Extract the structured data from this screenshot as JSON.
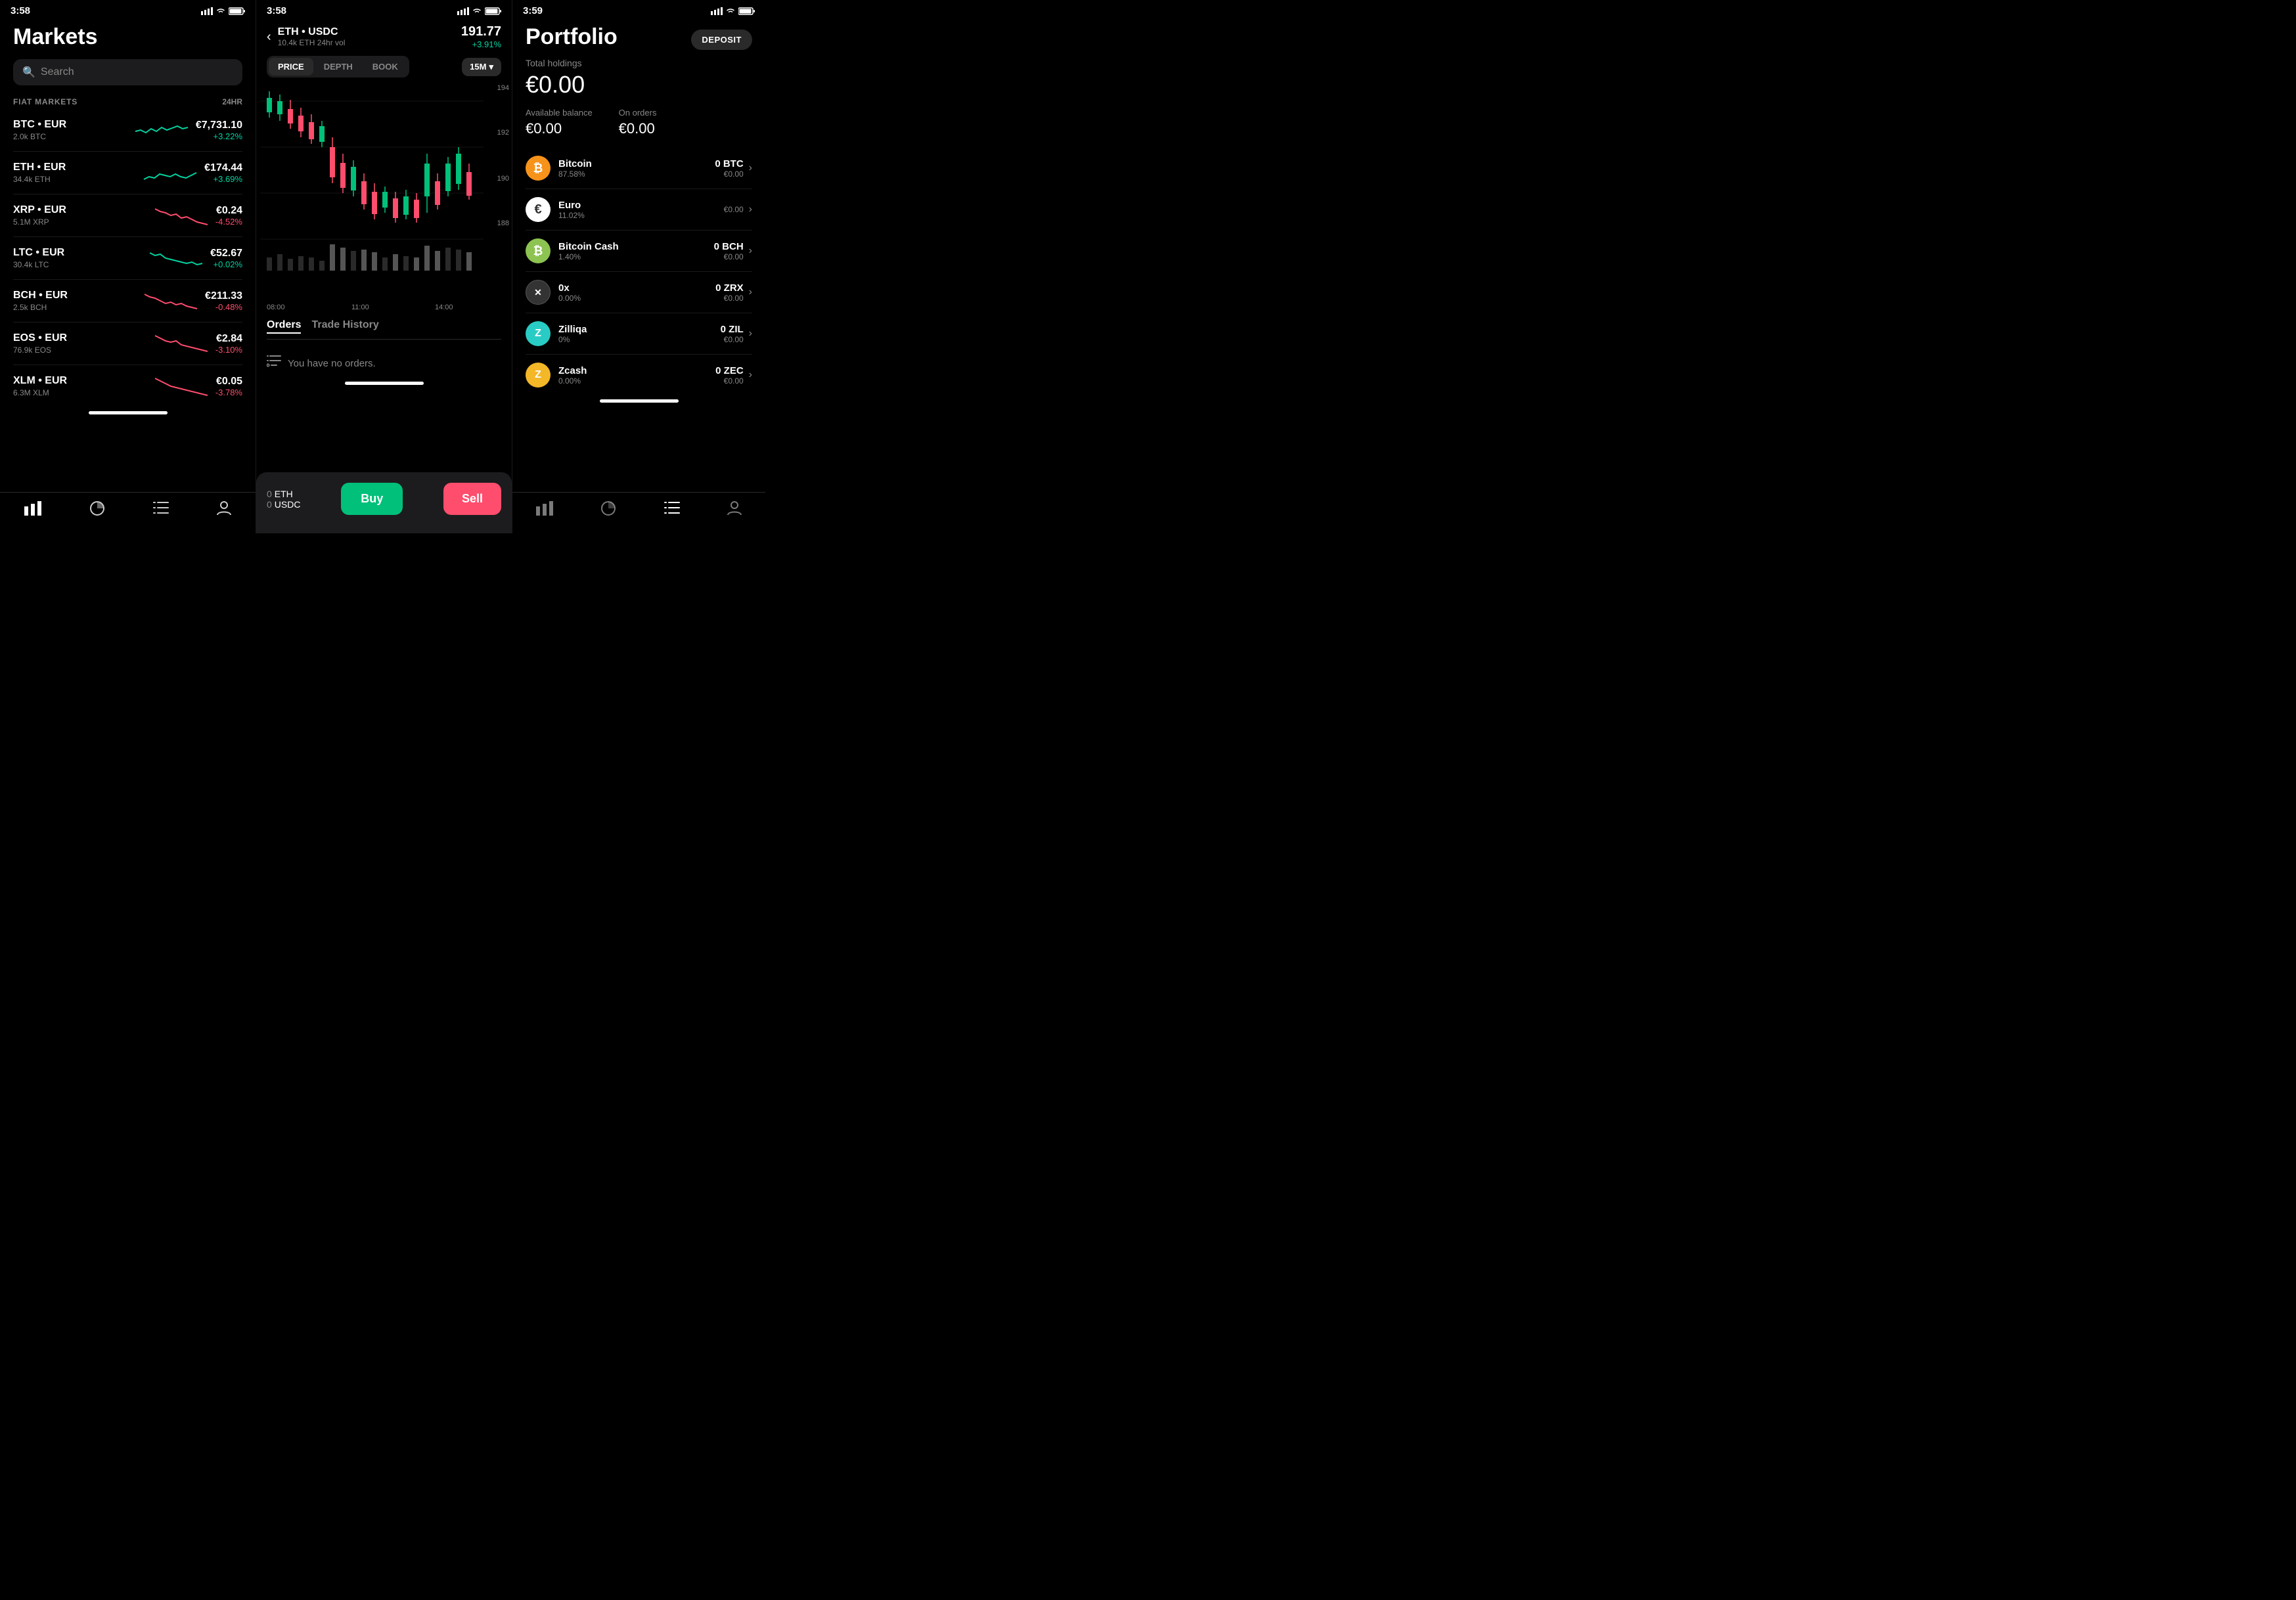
{
  "screens": {
    "left": {
      "status": {
        "time": "3:58",
        "icon": "location"
      },
      "title": "Markets",
      "search": {
        "placeholder": "Search"
      },
      "section": {
        "label": "FIAT MARKETS",
        "header24": "24HR"
      },
      "markets": [
        {
          "pair": "BTC • EUR",
          "vol": "2.0k BTC",
          "price": "€7,731.10",
          "change": "+3.22%",
          "positive": true
        },
        {
          "pair": "ETH • EUR",
          "vol": "34.4k ETH",
          "price": "€174.44",
          "change": "+3.69%",
          "positive": true
        },
        {
          "pair": "XRP • EUR",
          "vol": "5.1M XRP",
          "price": "€0.24",
          "change": "-4.52%",
          "positive": false
        },
        {
          "pair": "LTC • EUR",
          "vol": "30.4k LTC",
          "price": "€52.67",
          "change": "+0.02%",
          "positive": true
        },
        {
          "pair": "BCH • EUR",
          "vol": "2.5k BCH",
          "price": "€211.33",
          "change": "-0.48%",
          "positive": false
        },
        {
          "pair": "EOS • EUR",
          "vol": "76.9k EOS",
          "price": "€2.84",
          "change": "-3.10%",
          "positive": false
        },
        {
          "pair": "XLM • EUR",
          "vol": "6.3M XLM",
          "price": "€0.05",
          "change": "-3.78%",
          "positive": false
        }
      ],
      "nav": [
        "chart-bar",
        "pie-chart",
        "list",
        "person"
      ]
    },
    "middle": {
      "status": {
        "time": "3:58"
      },
      "pair": "ETH • USDC",
      "vol": "10.4k ETH 24hr vol",
      "price": "191.77",
      "change": "+3.91%",
      "tabs": [
        "PRICE",
        "DEPTH",
        "BOOK"
      ],
      "activeTab": "PRICE",
      "timeframe": "15M",
      "priceLabels": [
        "194",
        "192",
        "190",
        "188"
      ],
      "timeLabels": [
        "08:00",
        "11:00",
        "14:00"
      ],
      "ordersTabs": [
        "Orders",
        "Trade History"
      ],
      "noOrders": "You have no orders.",
      "tradeBar": {
        "ethBalance": "0 ETH",
        "usdcBalance": "0 USDC",
        "buyLabel": "Buy",
        "sellLabel": "Sell"
      }
    },
    "right": {
      "status": {
        "time": "3:59"
      },
      "title": "Portfolio",
      "depositLabel": "DEPOSIT",
      "totalHoldingsLabel": "Total holdings",
      "totalAmount": "€0.00",
      "availableLabel": "Available balance",
      "availableAmount": "€0.00",
      "onOrdersLabel": "On orders",
      "onOrdersAmount": "€0.00",
      "assets": [
        {
          "name": "Bitcoin",
          "symbol": "btc",
          "pct": "87.58%",
          "tokenAmt": "0 BTC",
          "eurAmt": "€0.00",
          "iconClass": "btc",
          "iconText": "₿"
        },
        {
          "name": "Euro",
          "symbol": "eur",
          "pct": "11.02%",
          "tokenAmt": "",
          "eurAmt": "€0.00",
          "iconClass": "eur",
          "iconText": "€"
        },
        {
          "name": "Bitcoin Cash",
          "symbol": "bch",
          "pct": "1.40%",
          "tokenAmt": "0 BCH",
          "eurAmt": "€0.00",
          "iconClass": "bch",
          "iconText": "₿"
        },
        {
          "name": "0x",
          "symbol": "zrx",
          "pct": "0.00%",
          "tokenAmt": "0 ZRX",
          "eurAmt": "€0.00",
          "iconClass": "zrx",
          "iconText": "✕"
        },
        {
          "name": "Zilliqa",
          "symbol": "zil",
          "pct": "0%",
          "tokenAmt": "0 ZIL",
          "eurAmt": "€0.00",
          "iconClass": "zil",
          "iconText": "Z"
        },
        {
          "name": "Zcash",
          "symbol": "zec",
          "pct": "0.00%",
          "tokenAmt": "0 ZEC",
          "eurAmt": "€0.00",
          "iconClass": "zec",
          "iconText": "ⓩ"
        }
      ],
      "nav": [
        "chart-bar",
        "pie-chart",
        "list",
        "person"
      ]
    }
  },
  "colors": {
    "positive": "#00d4a0",
    "negative": "#ff4d6d",
    "background": "#000000",
    "surface": "#1c1c1e",
    "text": "#ffffff",
    "muted": "#888888"
  }
}
